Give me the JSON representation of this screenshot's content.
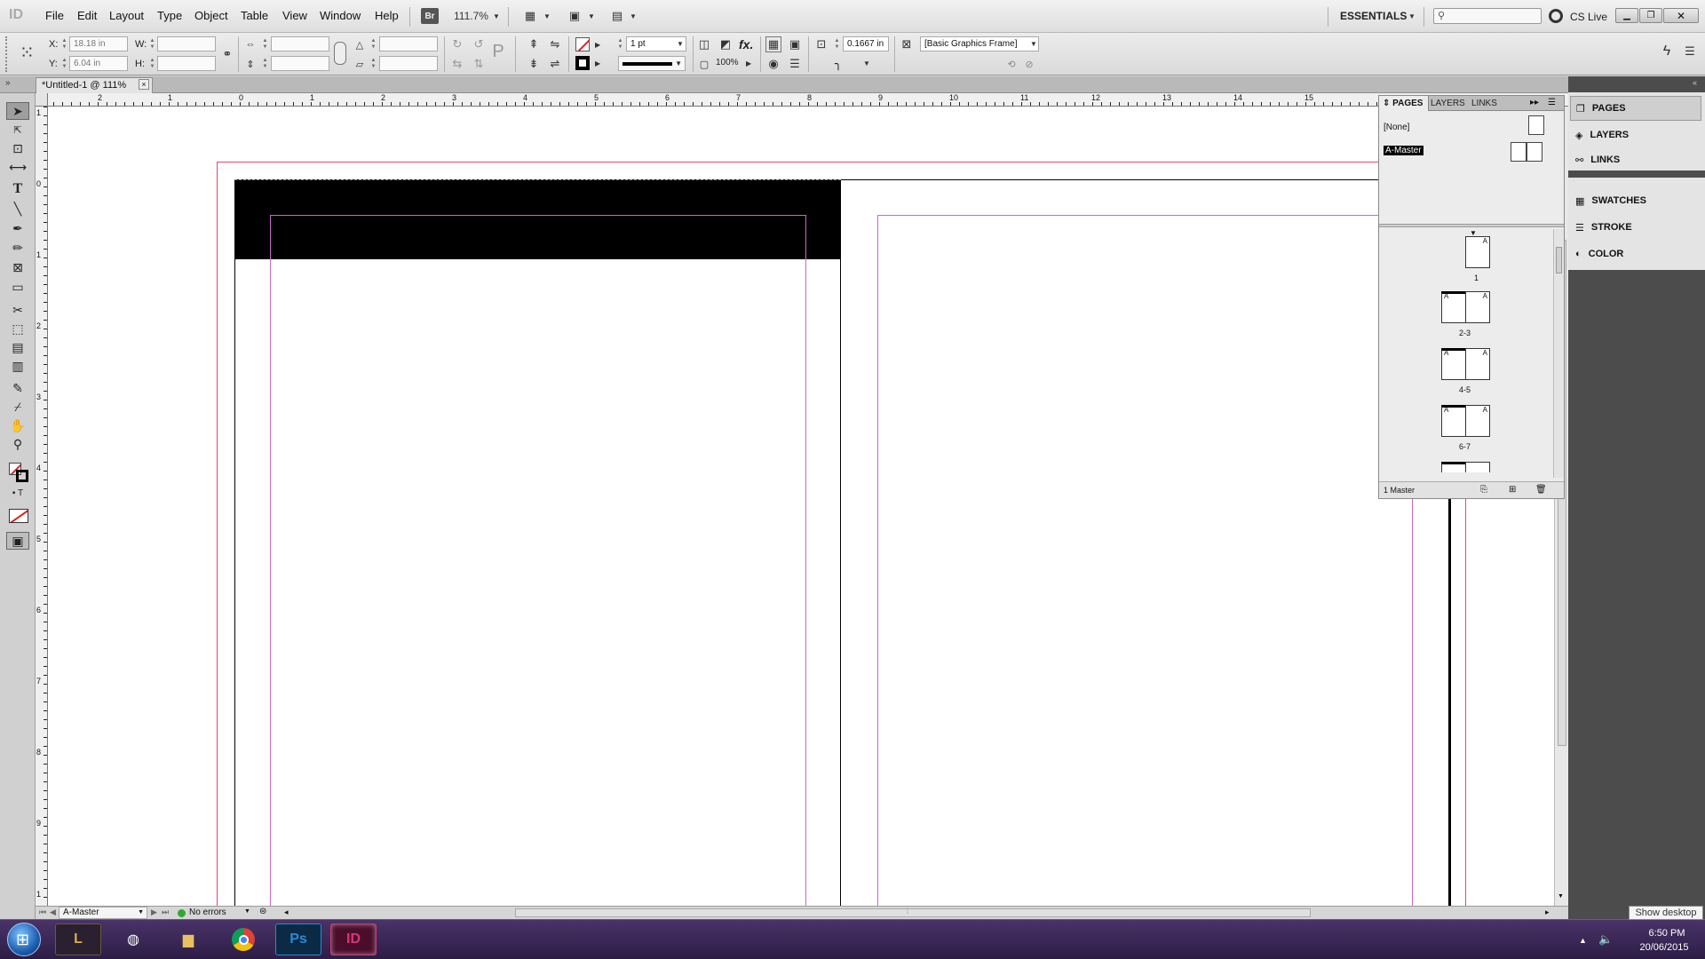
{
  "app": {
    "logo": "ID",
    "workspace": "ESSENTIALS",
    "cs_live": "CS Live",
    "bridge_label": "Br",
    "zoom": "111.7%",
    "search_placeholder": ""
  },
  "menu": [
    "File",
    "Edit",
    "Layout",
    "Type",
    "Object",
    "Table",
    "View",
    "Window",
    "Help"
  ],
  "control_panel": {
    "x_label": "X:",
    "x_value": "18.18 in",
    "y_label": "Y:",
    "y_value": "6.04 in",
    "w_label": "W:",
    "h_label": "H:",
    "stroke_weight": "1 pt",
    "opacity": "100%",
    "stroke_offset": "0.1667 in",
    "object_style": "[Basic Graphics Frame]",
    "fx_label": "fx."
  },
  "document": {
    "tab_title": "*Untitled-1 @ 111%",
    "tab_close": "×"
  },
  "rulers": {
    "horizontal": [
      "2",
      "1",
      "0",
      "1",
      "2",
      "3",
      "4",
      "5",
      "6",
      "7",
      "8",
      "9",
      "10",
      "11",
      "12",
      "13",
      "14",
      "15"
    ],
    "vertical": [
      "1",
      "0",
      "1",
      "2",
      "3",
      "4",
      "5",
      "6",
      "7",
      "8",
      "9",
      "1"
    ]
  },
  "pages_panel": {
    "tabs": [
      "PAGES",
      "LAYERS",
      "LINKS"
    ],
    "none_master": "[None]",
    "a_master": "A-Master",
    "master_letter": "A",
    "pages": [
      "1",
      "2-3",
      "4-5",
      "6-7"
    ],
    "footer_label": "1 Master"
  },
  "dock": {
    "items": [
      "PAGES",
      "LAYERS",
      "LINKS",
      "SWATCHES",
      "STROKE",
      "COLOR"
    ]
  },
  "status": {
    "page_field": "A-Master",
    "preflight": "No errors"
  },
  "taskbar": {
    "time": "6:50 PM",
    "date": "20/06/2015",
    "show_desktop": "Show desktop",
    "apps": [
      "L",
      "",
      "",
      "Ps",
      "ID"
    ]
  },
  "colors": {
    "margin_guide": "#cc66cc",
    "bleed_guide": "#ee4466",
    "page_edge": "#000000",
    "header_fill": "#000000",
    "indesign_pink": "#d4377a",
    "photoshop_blue": "#2a8ad6"
  }
}
